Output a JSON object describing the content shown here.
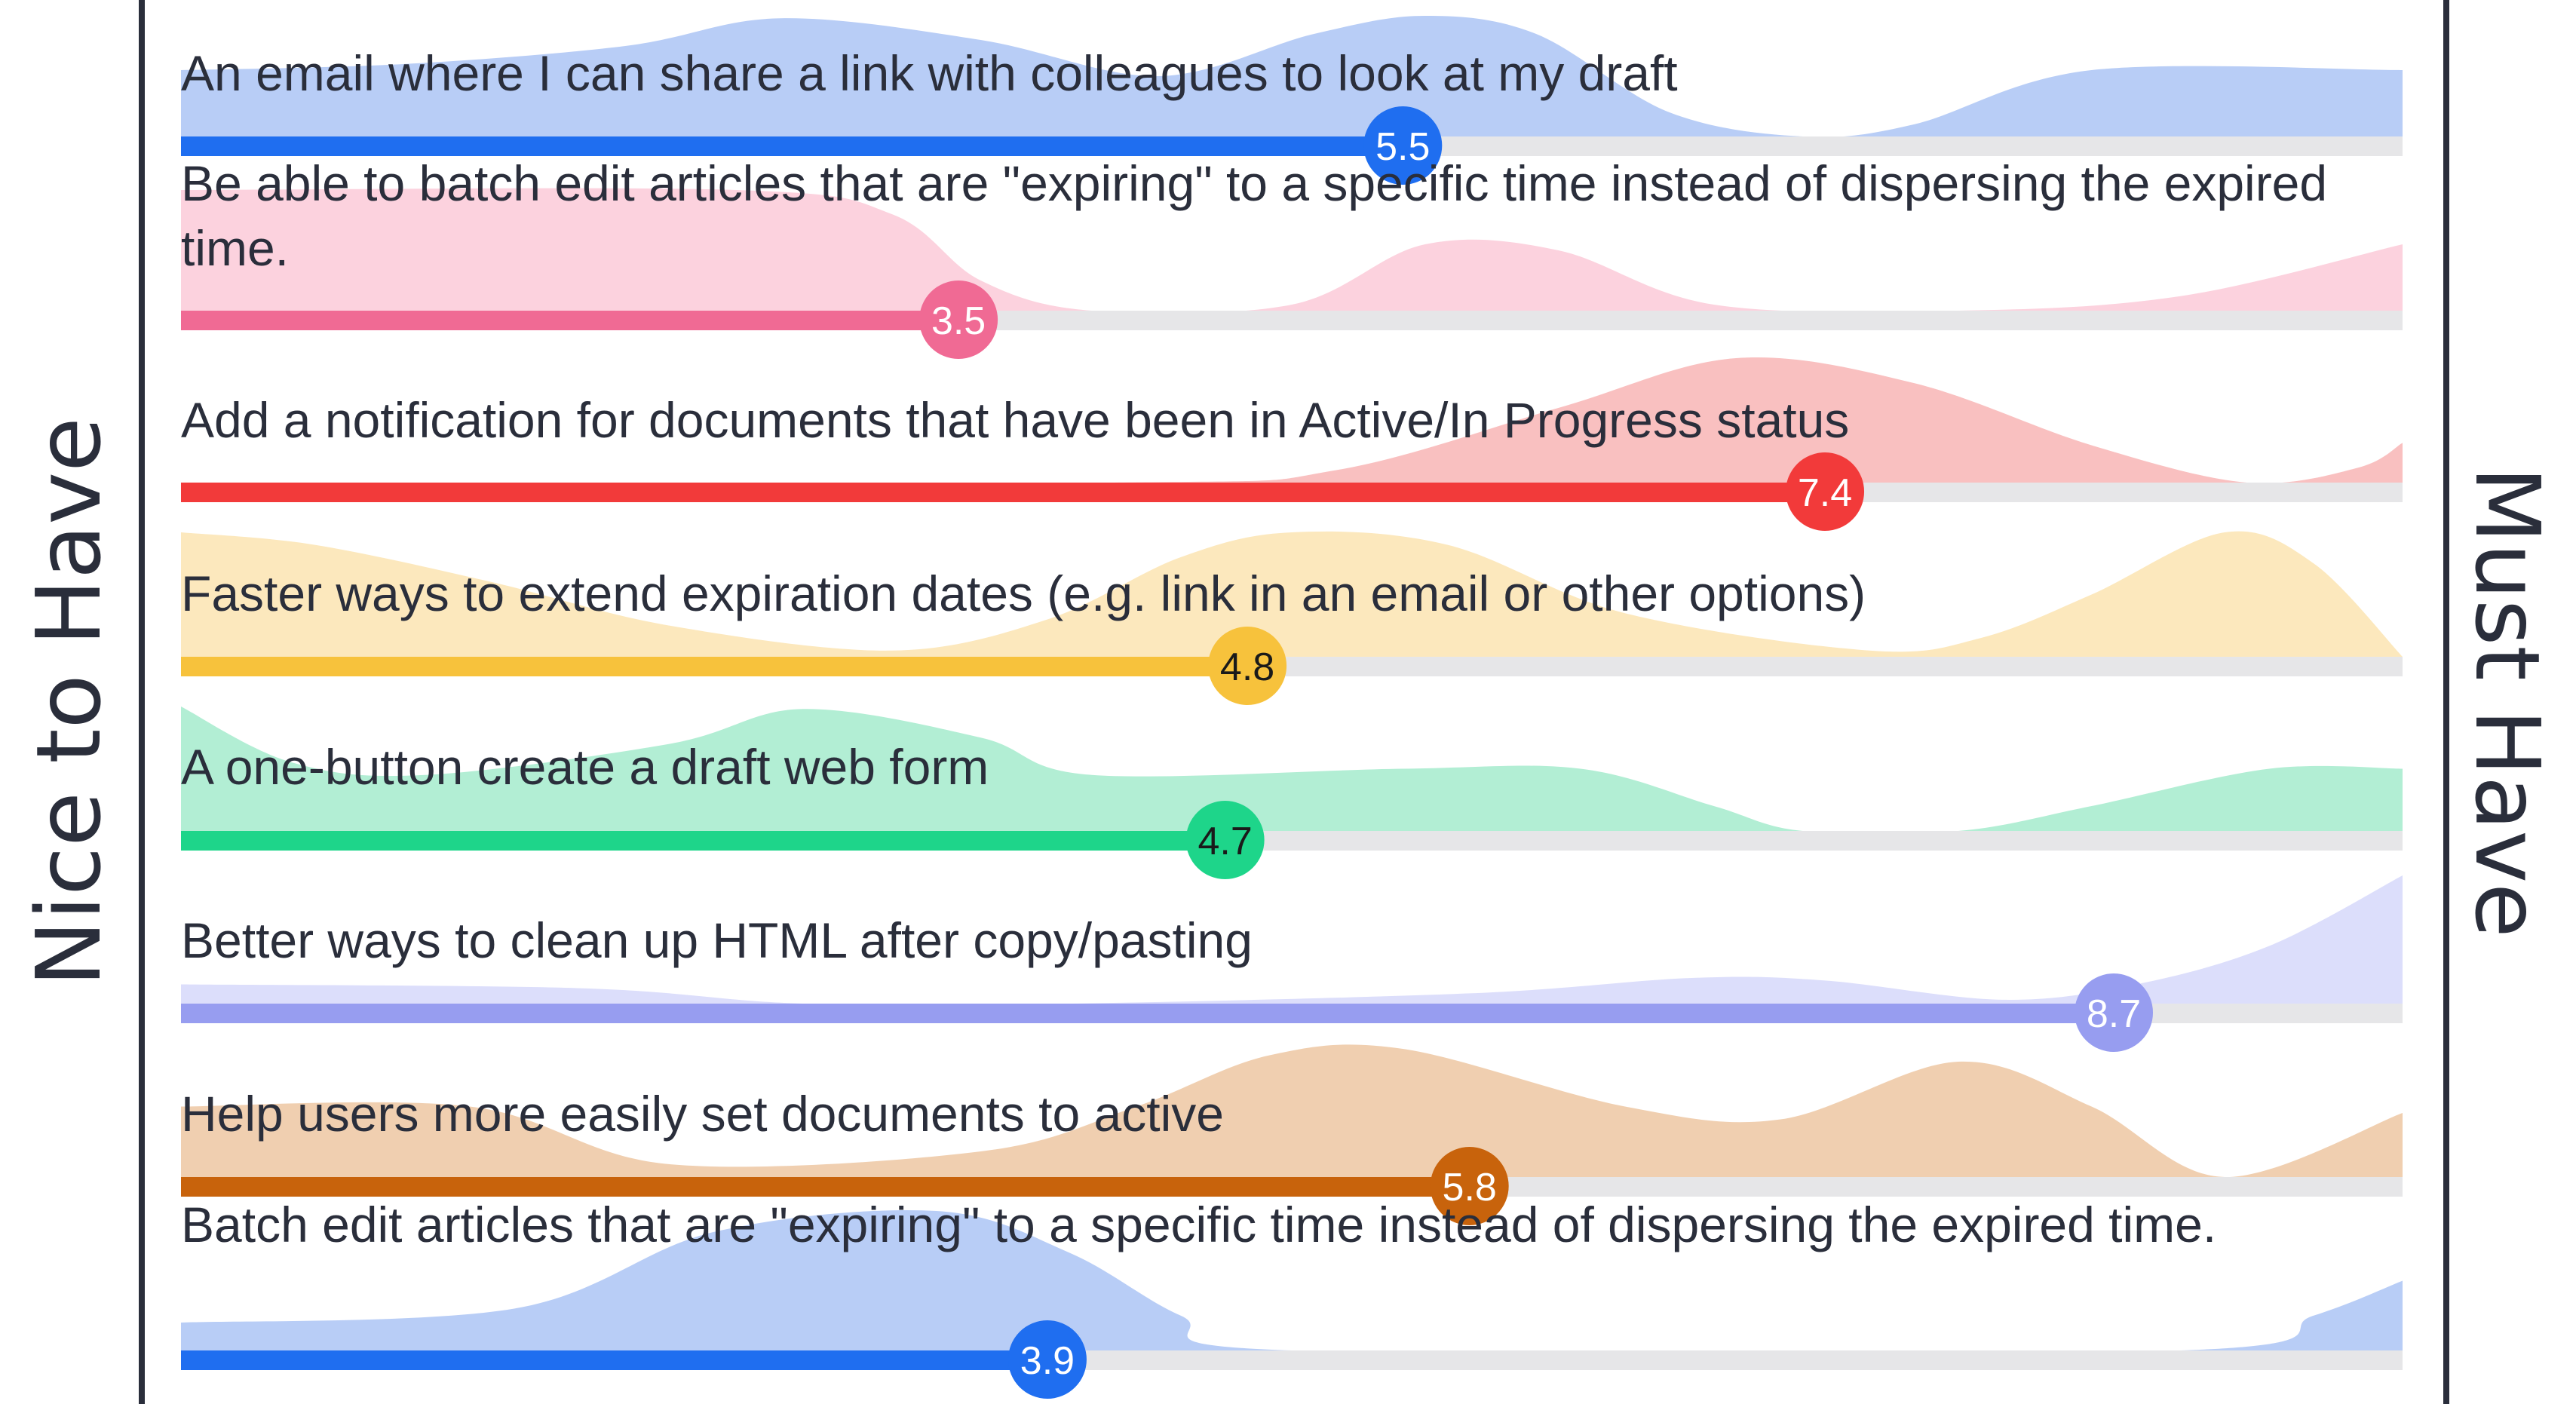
{
  "scale": {
    "left_label": "Nice to Have",
    "right_label": "Must Have"
  },
  "chart_data": {
    "type": "area",
    "xlim": [
      0,
      10
    ],
    "items": [
      {
        "label": "An email where I can share a link with colleagues to look at my draft",
        "value": 5.5,
        "color": "#1f6ef0",
        "fill": "#b8cdf6",
        "label_color": "#ffffff",
        "distribution": [
          [
            0,
            0.55
          ],
          [
            1,
            0.6
          ],
          [
            2,
            0.75
          ],
          [
            2.7,
            0.98
          ],
          [
            3.6,
            0.8
          ],
          [
            4.4,
            0.5
          ],
          [
            5.1,
            0.85
          ],
          [
            5.6,
            1.0
          ],
          [
            6.1,
            0.85
          ],
          [
            6.7,
            0.2
          ],
          [
            7.3,
            0.0
          ],
          [
            7.8,
            0.1
          ],
          [
            8.6,
            0.55
          ],
          [
            10,
            0.55
          ]
        ]
      },
      {
        "label": "Be able to batch edit articles that are \"expiring\" to a specific time instead of dispersing the expired time.",
        "value": 3.5,
        "color": "#f06a94",
        "fill": "#fcd2de",
        "label_color": "#ffffff",
        "distribution": [
          [
            0,
            1.0
          ],
          [
            2.5,
            1.0
          ],
          [
            3.2,
            0.8
          ],
          [
            3.6,
            0.25
          ],
          [
            4.1,
            0.0
          ],
          [
            5.0,
            0.05
          ],
          [
            5.6,
            0.55
          ],
          [
            6.2,
            0.5
          ],
          [
            6.9,
            0.05
          ],
          [
            8.0,
            0.0
          ],
          [
            9.0,
            0.12
          ],
          [
            10,
            0.55
          ]
        ]
      },
      {
        "label": "Add a notification for documents that have been in Active/In Progress status",
        "value": 7.4,
        "color": "#f23a3a",
        "fill": "#f9c0c0",
        "label_color": "#ffffff",
        "distribution": [
          [
            0,
            0.0
          ],
          [
            4.2,
            0.0
          ],
          [
            5.2,
            0.1
          ],
          [
            6.2,
            0.6
          ],
          [
            7.0,
            1.0
          ],
          [
            7.8,
            0.8
          ],
          [
            8.6,
            0.3
          ],
          [
            9.3,
            0.0
          ],
          [
            9.8,
            0.12
          ],
          [
            10,
            0.32
          ]
        ]
      },
      {
        "label": "Faster ways to extend expiration dates (e.g. link in an email or other options)",
        "value": 4.8,
        "color": "#f7c23c",
        "fill": "#fce8bd",
        "label_color": "#1a1a1a",
        "distribution": [
          [
            0,
            1.0
          ],
          [
            0.6,
            0.9
          ],
          [
            1.4,
            0.6
          ],
          [
            2.2,
            0.25
          ],
          [
            3.2,
            0.05
          ],
          [
            3.9,
            0.3
          ],
          [
            4.5,
            0.8
          ],
          [
            5.0,
            1.0
          ],
          [
            5.7,
            0.9
          ],
          [
            6.5,
            0.35
          ],
          [
            7.6,
            0.05
          ],
          [
            8.1,
            0.15
          ],
          [
            8.6,
            0.5
          ],
          [
            9.2,
            1.0
          ],
          [
            9.6,
            0.75
          ],
          [
            10,
            0.0
          ]
        ]
      },
      {
        "label": "A one-button create a draft web form",
        "value": 4.7,
        "color": "#1ed58a",
        "fill": "#b2eed4",
        "label_color": "#1a1a1a",
        "distribution": [
          [
            0,
            1.0
          ],
          [
            0.5,
            0.55
          ],
          [
            1.1,
            0.45
          ],
          [
            2.2,
            0.7
          ],
          [
            2.8,
            0.98
          ],
          [
            3.6,
            0.75
          ],
          [
            4.1,
            0.45
          ],
          [
            5.5,
            0.5
          ],
          [
            6.3,
            0.5
          ],
          [
            6.9,
            0.2
          ],
          [
            7.3,
            0.0
          ],
          [
            8.0,
            0.0
          ],
          [
            8.6,
            0.2
          ],
          [
            9.4,
            0.5
          ],
          [
            10,
            0.5
          ]
        ]
      },
      {
        "label": "Better ways to clean up HTML after copy/pasting",
        "value": 8.7,
        "color": "#979df0",
        "fill": "#dcdefb",
        "label_color": "#ffffff",
        "distribution": [
          [
            0,
            0.15
          ],
          [
            1.8,
            0.12
          ],
          [
            2.8,
            0.0
          ],
          [
            4.0,
            0.0
          ],
          [
            5.8,
            0.08
          ],
          [
            6.8,
            0.2
          ],
          [
            7.4,
            0.18
          ],
          [
            8.2,
            0.03
          ],
          [
            8.8,
            0.15
          ],
          [
            9.4,
            0.45
          ],
          [
            10,
            1.0
          ]
        ]
      },
      {
        "label": "Help users more easily set documents to active",
        "value": 5.8,
        "color": "#c8630c",
        "fill": "#f0cfb0",
        "label_color": "#ffffff",
        "distribution": [
          [
            0,
            0.55
          ],
          [
            1.3,
            0.55
          ],
          [
            2.2,
            0.1
          ],
          [
            3.6,
            0.2
          ],
          [
            4.3,
            0.55
          ],
          [
            4.9,
            0.95
          ],
          [
            5.5,
            1.0
          ],
          [
            6.5,
            0.55
          ],
          [
            7.2,
            0.45
          ],
          [
            8.0,
            0.9
          ],
          [
            8.6,
            0.55
          ],
          [
            9.2,
            0.0
          ],
          [
            10,
            0.5
          ]
        ]
      },
      {
        "label": "Batch edit articles that are \"expiring\" to a specific time instead of dispersing the expired time.",
        "value": 3.9,
        "color": "#1f6ef0",
        "fill": "#b8cdf6",
        "label_color": "#ffffff",
        "distribution": [
          [
            0,
            0.2
          ],
          [
            1.5,
            0.3
          ],
          [
            2.4,
            0.85
          ],
          [
            3.4,
            1.0
          ],
          [
            4.0,
            0.7
          ],
          [
            4.5,
            0.25
          ],
          [
            5.0,
            0.0
          ],
          [
            9.0,
            0.0
          ],
          [
            9.6,
            0.25
          ],
          [
            10,
            0.5
          ]
        ]
      }
    ]
  }
}
